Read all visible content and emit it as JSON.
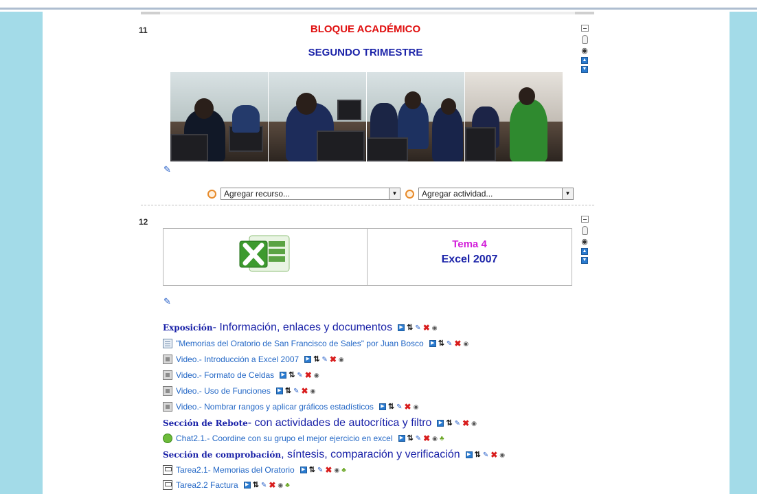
{
  "section11": {
    "number": "11",
    "title": "BLOQUE ACADÉMICO",
    "subtitle": "SEGUNDO TRIMESTRE"
  },
  "add_resource": {
    "selected": "Agregar recurso..."
  },
  "add_activity": {
    "selected": "Agregar actividad..."
  },
  "section12": {
    "number": "12",
    "tema": "Tema 4",
    "topic": "Excel 2007"
  },
  "items": [
    {
      "kind": "header",
      "bold": "Exposición",
      "rest": " - Información, enlaces y documentos"
    },
    {
      "kind": "doc",
      "text": "\"Memorias del Oratorio de San Francisco de Sales\" por Juan Bosco"
    },
    {
      "kind": "video",
      "text": "Video.- Introducción a Excel 2007"
    },
    {
      "kind": "video",
      "text": "Video.- Formato de Celdas"
    },
    {
      "kind": "video",
      "text": "Video.- Uso de Funciones"
    },
    {
      "kind": "video",
      "text": "Video.- Nombrar rangos y aplicar gráficos estadísticos"
    },
    {
      "kind": "header",
      "bold": "Sección de Rebote",
      "rest": " - con actividades de autocrítica y filtro"
    },
    {
      "kind": "chat",
      "text": "Chat2.1.- Coordine con su grupo el mejor ejercicio en excel"
    },
    {
      "kind": "header",
      "bold": "Sección de comprobación",
      "rest": ", síntesis, comparación y verificación"
    },
    {
      "kind": "task",
      "text": "Tarea2.1- Memorias del Oratorio"
    },
    {
      "kind": "task",
      "text": "Tarea2.2 Factura"
    }
  ],
  "icons": {
    "collapse": "collapse-icon",
    "highlight": "lightbulb-icon",
    "visibility": "eye-icon",
    "move_up": "arrow-up-icon",
    "move_down": "arrow-down-icon",
    "edit": "pencil-icon",
    "delete": "delete-x-icon",
    "indent": "move-right-icon",
    "move": "move-updown-icon",
    "group": "group-icon",
    "excel": "excel-logo-icon"
  },
  "colors": {
    "side_panel": "#a3dbe8",
    "title_red": "#e01010",
    "title_blue": "#1a22a8",
    "tema_magenta": "#d21ed9",
    "link_blue": "#2468c6"
  }
}
